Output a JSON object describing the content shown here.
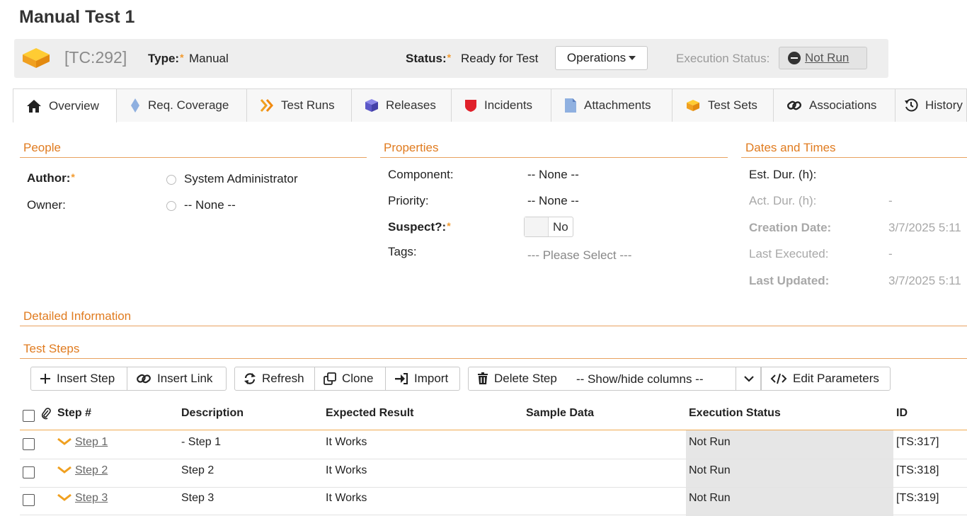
{
  "title": "Manual Test 1",
  "header": {
    "id": "[TC:292]",
    "type_label": "Type:",
    "type_value": "Manual",
    "status_label": "Status:",
    "status_value": "Ready for Test",
    "operations_label": "Operations",
    "execution_status_label": "Execution Status:",
    "execution_status_value": "Not Run"
  },
  "tabs": [
    {
      "label": "Overview",
      "icon": "home-icon"
    },
    {
      "label": "Req. Coverage",
      "icon": "diamond-icon"
    },
    {
      "label": "Test Runs",
      "icon": "chevrons-icon"
    },
    {
      "label": "Releases",
      "icon": "cube-icon"
    },
    {
      "label": "Incidents",
      "icon": "shield-icon"
    },
    {
      "label": "Attachments",
      "icon": "document-icon"
    },
    {
      "label": "Test Sets",
      "icon": "testsets-icon"
    },
    {
      "label": "Associations",
      "icon": "link-icon"
    },
    {
      "label": "History",
      "icon": "history-icon"
    }
  ],
  "people": {
    "heading": "People",
    "author_label": "Author:",
    "author_value": "System Administrator",
    "owner_label": "Owner:",
    "owner_value": "-- None --"
  },
  "properties": {
    "heading": "Properties",
    "component_label": "Component:",
    "component_value": "-- None --",
    "priority_label": "Priority:",
    "priority_value": "-- None --",
    "suspect_label": "Suspect?:",
    "suspect_value": "No",
    "tags_label": "Tags:",
    "tags_placeholder": "--- Please Select ---"
  },
  "dates": {
    "heading": "Dates and Times",
    "est_dur_label": "Est. Dur. (h):",
    "act_dur_label": "Act. Dur. (h):",
    "act_dur_value": "-",
    "creation_label": "Creation Date:",
    "creation_value": "3/7/2025 5:11",
    "last_executed_label": "Last Executed:",
    "last_executed_value": "-",
    "last_updated_label": "Last Updated:",
    "last_updated_value": "3/7/2025 5:11"
  },
  "detailed_heading": "Detailed Information",
  "steps_heading": "Test Steps",
  "toolbar": {
    "insert_step": "Insert Step",
    "insert_link": "Insert Link",
    "refresh": "Refresh",
    "clone": "Clone",
    "import": "Import",
    "delete_step": "Delete Step",
    "show_hide": "-- Show/hide columns --",
    "edit_parameters": "Edit Parameters"
  },
  "table": {
    "columns": [
      "Step #",
      "Description",
      "Expected Result",
      "Sample Data",
      "Execution Status",
      "ID"
    ],
    "rows": [
      {
        "step": "Step 1",
        "description": "- Step 1",
        "expected": "It Works",
        "sample": "",
        "status": "Not Run",
        "id": "[TS:317]"
      },
      {
        "step": "Step 2",
        "description": "Step 2",
        "expected": "It Works",
        "sample": "",
        "status": "Not Run",
        "id": "[TS:318]"
      },
      {
        "step": "Step 3",
        "description": "Step 3",
        "expected": "It Works",
        "sample": "",
        "status": "Not Run",
        "id": "[TS:319]"
      }
    ]
  },
  "colors": {
    "accent": "#e07b1f",
    "star": "#f29a2e",
    "status_bg": "#e6e6e6"
  }
}
